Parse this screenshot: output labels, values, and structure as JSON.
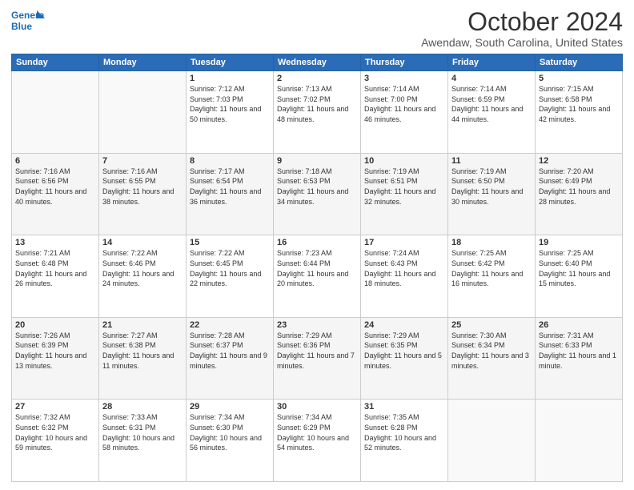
{
  "logo": {
    "line1": "General",
    "line2": "Blue"
  },
  "title": "October 2024",
  "subtitle": "Awendaw, South Carolina, United States",
  "days_header": [
    "Sunday",
    "Monday",
    "Tuesday",
    "Wednesday",
    "Thursday",
    "Friday",
    "Saturday"
  ],
  "weeks": [
    [
      {
        "day": "",
        "info": ""
      },
      {
        "day": "",
        "info": ""
      },
      {
        "day": "1",
        "info": "Sunrise: 7:12 AM\nSunset: 7:03 PM\nDaylight: 11 hours and 50 minutes."
      },
      {
        "day": "2",
        "info": "Sunrise: 7:13 AM\nSunset: 7:02 PM\nDaylight: 11 hours and 48 minutes."
      },
      {
        "day": "3",
        "info": "Sunrise: 7:14 AM\nSunset: 7:00 PM\nDaylight: 11 hours and 46 minutes."
      },
      {
        "day": "4",
        "info": "Sunrise: 7:14 AM\nSunset: 6:59 PM\nDaylight: 11 hours and 44 minutes."
      },
      {
        "day": "5",
        "info": "Sunrise: 7:15 AM\nSunset: 6:58 PM\nDaylight: 11 hours and 42 minutes."
      }
    ],
    [
      {
        "day": "6",
        "info": "Sunrise: 7:16 AM\nSunset: 6:56 PM\nDaylight: 11 hours and 40 minutes."
      },
      {
        "day": "7",
        "info": "Sunrise: 7:16 AM\nSunset: 6:55 PM\nDaylight: 11 hours and 38 minutes."
      },
      {
        "day": "8",
        "info": "Sunrise: 7:17 AM\nSunset: 6:54 PM\nDaylight: 11 hours and 36 minutes."
      },
      {
        "day": "9",
        "info": "Sunrise: 7:18 AM\nSunset: 6:53 PM\nDaylight: 11 hours and 34 minutes."
      },
      {
        "day": "10",
        "info": "Sunrise: 7:19 AM\nSunset: 6:51 PM\nDaylight: 11 hours and 32 minutes."
      },
      {
        "day": "11",
        "info": "Sunrise: 7:19 AM\nSunset: 6:50 PM\nDaylight: 11 hours and 30 minutes."
      },
      {
        "day": "12",
        "info": "Sunrise: 7:20 AM\nSunset: 6:49 PM\nDaylight: 11 hours and 28 minutes."
      }
    ],
    [
      {
        "day": "13",
        "info": "Sunrise: 7:21 AM\nSunset: 6:48 PM\nDaylight: 11 hours and 26 minutes."
      },
      {
        "day": "14",
        "info": "Sunrise: 7:22 AM\nSunset: 6:46 PM\nDaylight: 11 hours and 24 minutes."
      },
      {
        "day": "15",
        "info": "Sunrise: 7:22 AM\nSunset: 6:45 PM\nDaylight: 11 hours and 22 minutes."
      },
      {
        "day": "16",
        "info": "Sunrise: 7:23 AM\nSunset: 6:44 PM\nDaylight: 11 hours and 20 minutes."
      },
      {
        "day": "17",
        "info": "Sunrise: 7:24 AM\nSunset: 6:43 PM\nDaylight: 11 hours and 18 minutes."
      },
      {
        "day": "18",
        "info": "Sunrise: 7:25 AM\nSunset: 6:42 PM\nDaylight: 11 hours and 16 minutes."
      },
      {
        "day": "19",
        "info": "Sunrise: 7:25 AM\nSunset: 6:40 PM\nDaylight: 11 hours and 15 minutes."
      }
    ],
    [
      {
        "day": "20",
        "info": "Sunrise: 7:26 AM\nSunset: 6:39 PM\nDaylight: 11 hours and 13 minutes."
      },
      {
        "day": "21",
        "info": "Sunrise: 7:27 AM\nSunset: 6:38 PM\nDaylight: 11 hours and 11 minutes."
      },
      {
        "day": "22",
        "info": "Sunrise: 7:28 AM\nSunset: 6:37 PM\nDaylight: 11 hours and 9 minutes."
      },
      {
        "day": "23",
        "info": "Sunrise: 7:29 AM\nSunset: 6:36 PM\nDaylight: 11 hours and 7 minutes."
      },
      {
        "day": "24",
        "info": "Sunrise: 7:29 AM\nSunset: 6:35 PM\nDaylight: 11 hours and 5 minutes."
      },
      {
        "day": "25",
        "info": "Sunrise: 7:30 AM\nSunset: 6:34 PM\nDaylight: 11 hours and 3 minutes."
      },
      {
        "day": "26",
        "info": "Sunrise: 7:31 AM\nSunset: 6:33 PM\nDaylight: 11 hours and 1 minute."
      }
    ],
    [
      {
        "day": "27",
        "info": "Sunrise: 7:32 AM\nSunset: 6:32 PM\nDaylight: 10 hours and 59 minutes."
      },
      {
        "day": "28",
        "info": "Sunrise: 7:33 AM\nSunset: 6:31 PM\nDaylight: 10 hours and 58 minutes."
      },
      {
        "day": "29",
        "info": "Sunrise: 7:34 AM\nSunset: 6:30 PM\nDaylight: 10 hours and 56 minutes."
      },
      {
        "day": "30",
        "info": "Sunrise: 7:34 AM\nSunset: 6:29 PM\nDaylight: 10 hours and 54 minutes."
      },
      {
        "day": "31",
        "info": "Sunrise: 7:35 AM\nSunset: 6:28 PM\nDaylight: 10 hours and 52 minutes."
      },
      {
        "day": "",
        "info": ""
      },
      {
        "day": "",
        "info": ""
      }
    ]
  ]
}
